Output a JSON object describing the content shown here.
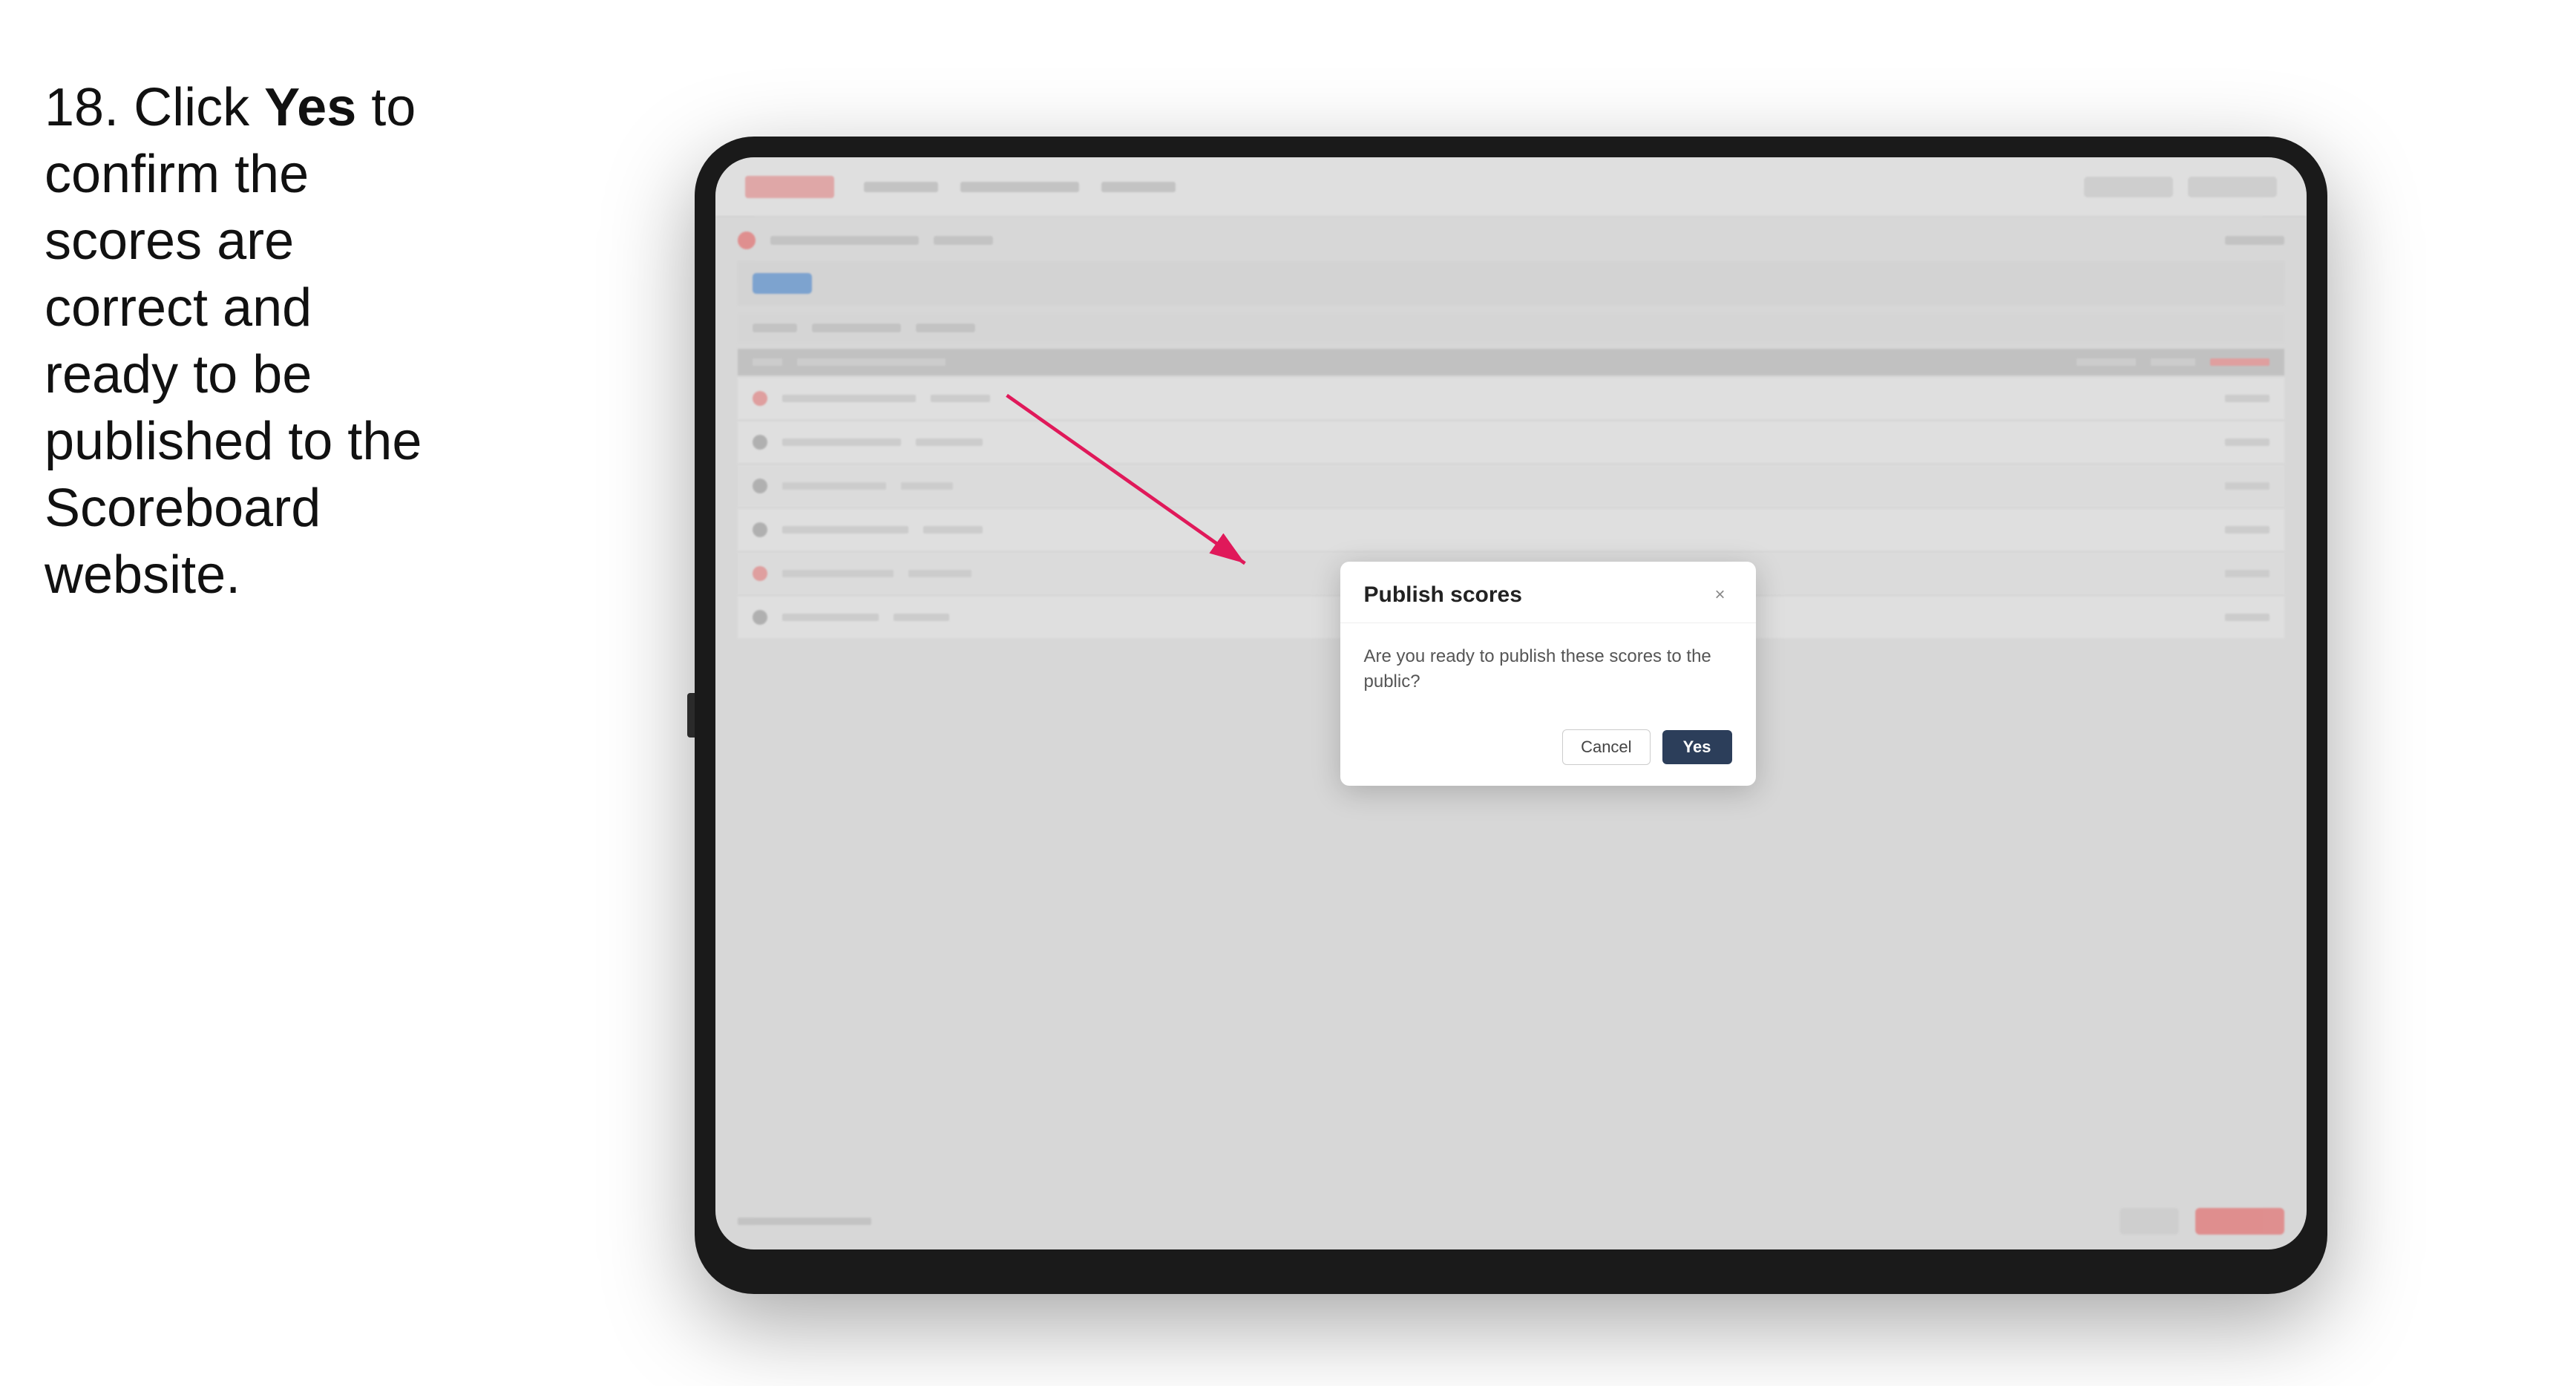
{
  "instruction": {
    "step_number": "18.",
    "text_parts": [
      {
        "text": "Click ",
        "bold": false
      },
      {
        "text": "Yes",
        "bold": true
      },
      {
        "text": " to confirm the scores are correct and ready to be published to the Scoreboard website.",
        "bold": false
      }
    ],
    "full_text": "18. Click Yes to confirm the scores are correct and ready to be published to the Scoreboard website."
  },
  "dialog": {
    "title": "Publish scores",
    "message": "Are you ready to publish these scores to the public?",
    "close_label": "×",
    "cancel_label": "Cancel",
    "yes_label": "Yes"
  },
  "colors": {
    "accent": "#2c3e5a",
    "danger": "#ff6b6b",
    "arrow": "#e0195a"
  }
}
